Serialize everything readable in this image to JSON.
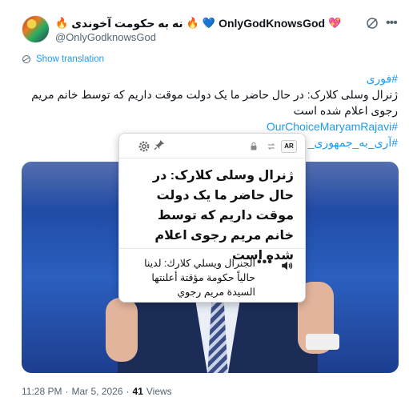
{
  "tweet": {
    "display_name": "OnlyGodKnowsGod",
    "display_name_suffix": "نه به حکومت آخوندی",
    "handle": "@OnlyGodknowsGod",
    "show_translation": "Show translation",
    "hashtag_foree": "#فوری",
    "body_line": "ژنرال وسلی کلارک: در حال حاضر ما یک دولت موقت داریم که توسط خانم مریم رجوی اعلام شده است",
    "hashtag_choice": "#OurChoiceMaryamRajavi",
    "hashtag_republic": "#آری_به_جمهوری_",
    "time": "11:28 PM",
    "dot": "·",
    "date": "Mar 5, 2026",
    "views_count": "41",
    "views_label": "Views"
  },
  "popup": {
    "source_lang": "AR",
    "translation_fa": "ژنرال وسلی کلارک: در حال حاضر ما یک دولت موقت داریم که توسط خانم مریم رجوی اعلام شده است",
    "translation_ar": "الجنرال ويسلي كلارك: لدينا حالياً حكومة مؤقتة أعلنتها السيدة مريم رجوي",
    "more": "•••"
  },
  "icons": {
    "grok": "grok-icon",
    "more": "more-horizontal-icon",
    "globe": "translate-globe-icon",
    "gear": "gear-icon",
    "pin": "pin-icon",
    "speaker": "speaker-icon"
  },
  "colors": {
    "link": "#1d9bf0",
    "text": "#0f1419",
    "muted": "#536471"
  }
}
